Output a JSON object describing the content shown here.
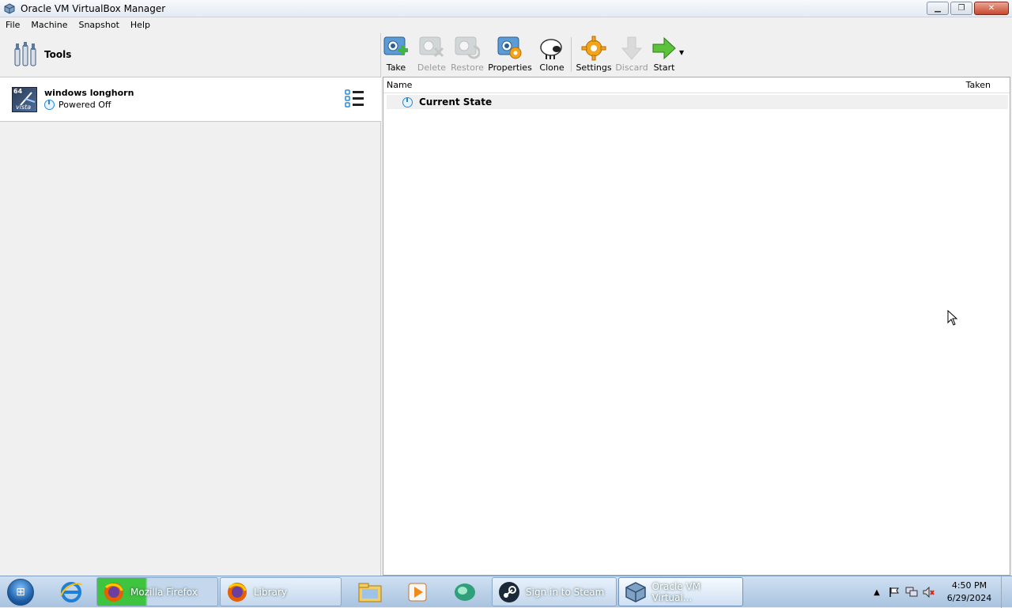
{
  "window": {
    "title": "Oracle VM VirtualBox Manager"
  },
  "menu": [
    "File",
    "Machine",
    "Snapshot",
    "Help"
  ],
  "tools": {
    "label": "Tools"
  },
  "vm": {
    "name": "windows longhorn",
    "state": "Powered Off",
    "os_badge": "64",
    "os_label": "vista"
  },
  "toolbar": {
    "take": "Take",
    "delete": "Delete",
    "restore": "Restore",
    "properties": "Properties",
    "clone": "Clone",
    "settings": "Settings",
    "discard": "Discard",
    "start": "Start"
  },
  "snapshots": {
    "col_name": "Name",
    "col_taken": "Taken",
    "current_state": "Current State"
  },
  "taskbar": {
    "firefox": "Mozilla Firefox",
    "library": "Library",
    "steam": "Sign in to Steam",
    "vbox": "Oracle VM Virtual...",
    "time": "4:50 PM",
    "date": "6/29/2024"
  }
}
